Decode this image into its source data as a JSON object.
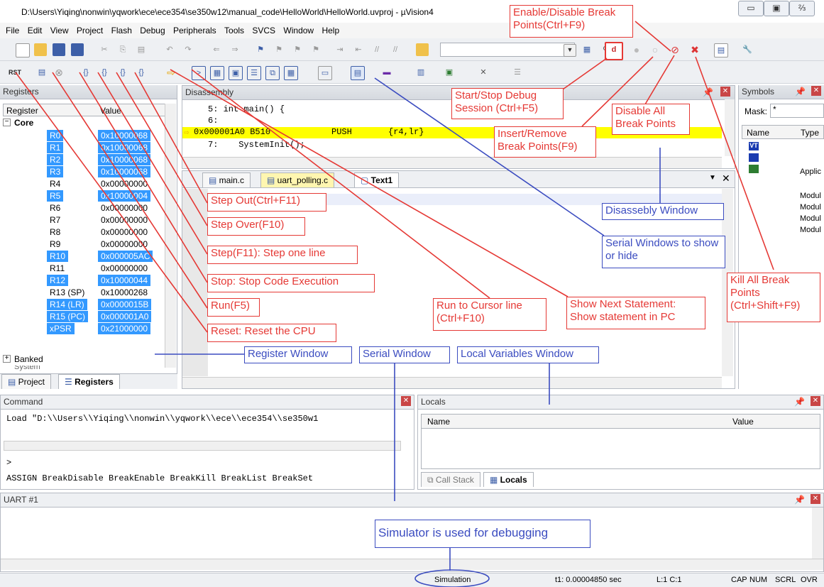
{
  "window": {
    "title": "D:\\Users\\Yiqing\\nonwin\\yqwork\\ece\\ece354\\se350w12\\manual_code\\HelloWorld\\HelloWorld.uvproj - µVision4",
    "minimize": "▭",
    "restore": "▣",
    "close": "⅔"
  },
  "menu": [
    "File",
    "Edit",
    "View",
    "Project",
    "Flash",
    "Debug",
    "Peripherals",
    "Tools",
    "SVCS",
    "Window",
    "Help"
  ],
  "registers_panel": {
    "title": "Registers",
    "col_register": "Register",
    "col_value": "Value",
    "group": "Core",
    "rows": [
      {
        "name": "R0",
        "value": "0x10000068",
        "sel": true
      },
      {
        "name": "R1",
        "value": "0x10000068",
        "sel": true
      },
      {
        "name": "R2",
        "value": "0x10000068",
        "sel": true
      },
      {
        "name": "R3",
        "value": "0x10000068",
        "sel": true
      },
      {
        "name": "R4",
        "value": "0x00000000",
        "sel": false
      },
      {
        "name": "R5",
        "value": "0x10000004",
        "sel": true
      },
      {
        "name": "R6",
        "value": "0x00000000",
        "sel": false
      },
      {
        "name": "R7",
        "value": "0x00000000",
        "sel": false
      },
      {
        "name": "R8",
        "value": "0x00000000",
        "sel": false
      },
      {
        "name": "R9",
        "value": "0x00000000",
        "sel": false
      },
      {
        "name": "R10",
        "value": "0x000005AC",
        "sel": true
      },
      {
        "name": "R11",
        "value": "0x00000000",
        "sel": false
      },
      {
        "name": "R12",
        "value": "0x10000044",
        "sel": true
      },
      {
        "name": "R13 (SP)",
        "value": "0x10000268",
        "sel": false
      },
      {
        "name": "R14 (LR)",
        "value": "0x0000015B",
        "sel": true
      },
      {
        "name": "R15 (PC)",
        "value": "0x000001A0",
        "sel": true
      },
      {
        "name": "xPSR",
        "value": "0x21000000",
        "sel": true
      }
    ],
    "banked": "Banked",
    "system": "System",
    "tab_project": "Project",
    "tab_registers": "Registers"
  },
  "disassembly": {
    "title": "Disassembly",
    "line1": "     5: int main() {",
    "line2": "     6:",
    "line3_addr": "0x000001A0 B510",
    "line3_op": "PUSH",
    "line3_args": "{r4,lr}",
    "line4": "     7:    SystemInit();"
  },
  "editor_tabs": [
    "main.c",
    "uart_polling.c",
    "Text1"
  ],
  "symbols": {
    "title": "Symbols",
    "mask_label": "Mask:",
    "mask_value": "*",
    "col_name": "Name",
    "col_type": "Type",
    "types": [
      "Applic",
      "Modul",
      "Modul",
      "Modul",
      "Modul"
    ]
  },
  "command": {
    "title": "Command",
    "output": "Load \"D:\\\\Users\\\\Yiqing\\\\nonwin\\\\yqwork\\\\ece\\\\ece354\\\\se350w1",
    "prompt": ">",
    "hint": "ASSIGN BreakDisable BreakEnable BreakKill BreakList BreakSet"
  },
  "locals": {
    "title": "Locals",
    "col_name": "Name",
    "col_value": "Value",
    "tab_callstack": "Call Stack",
    "tab_locals": "Locals"
  },
  "uart": {
    "title": "UART #1"
  },
  "status": {
    "mode": "Simulation",
    "time": "t1: 0.00004850 sec",
    "pos": "L:1 C:1",
    "caps": "CAP",
    "num": "NUM",
    "scrl": "SCRL",
    "ovr": "OVR"
  },
  "annotations": {
    "enable_disable": "Enable/Disable Break Points(Ctrl+F9)",
    "start_stop": "Start/Stop Debug Session (Ctrl+F5)",
    "disable_all": "Disable All Break Points",
    "insert_remove": "Insert/Remove Break Points(F9)",
    "disassembly_window": "Disassebly Window",
    "serial_windows": "Serial Windows to show or hide",
    "kill_all": "Kill All Break Points (Ctrl+Shift+F9)",
    "step_out": "Step Out(Ctrl+F11)",
    "step_over": "Step Over(F10)",
    "step": "Step(F11): Step one line",
    "stop": "Stop: Stop Code Execution",
    "run": "Run(F5)",
    "reset": "Reset: Reset the CPU",
    "run_to_cursor": "Run to Cursor line (Ctrl+F10)",
    "show_next": "Show Next Statement: Show statement in PC",
    "register_window": "Register Window",
    "serial_window": "Serial Window",
    "local_vars": "Local Variables Window",
    "simulator": "Simulator is used for debugging"
  },
  "colors": {
    "red_annotation": "#e53935",
    "blue_annotation": "#3b4cc0",
    "selection": "#3399ff",
    "current_line": "#ffff00"
  }
}
